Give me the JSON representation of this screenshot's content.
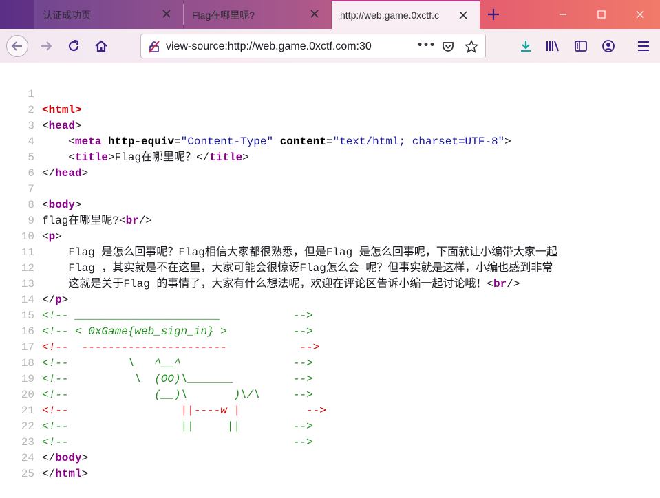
{
  "tabs": [
    {
      "label": "认证成功页",
      "active": false
    },
    {
      "label": "Flag在哪里呢?",
      "active": false
    },
    {
      "label": "http://web.game.0xctf.c",
      "active": true
    }
  ],
  "navbar": {
    "url": "view-source:http://web.game.0xctf.com:30",
    "more_label": "•••"
  },
  "source": {
    "line_numbers": [
      "1",
      "2",
      "3",
      "4",
      "5",
      "6",
      "7",
      "8",
      "9",
      "10",
      "11",
      "12",
      "13",
      "14",
      "15",
      "16",
      "17",
      "18",
      "19",
      "20",
      "21",
      "22",
      "23",
      "24",
      "25"
    ],
    "html_open": "html",
    "head_open": "head",
    "meta_tag": "meta",
    "meta_attr1": "http-equiv",
    "meta_val1": "\"Content-Type\"",
    "meta_attr2": "content",
    "meta_val2": "\"text/html; charset=UTF-8\"",
    "title_tag": "title",
    "title_text": "Flag在哪里呢？",
    "head_close": "head",
    "body_open": "body",
    "line8_text": "flag在哪里呢?",
    "br_tag": "br",
    "p_tag": "p",
    "para1": "Flag 是怎么回事呢？Flag相信大家都很熟悉，但是Flag 是怎么回事呢，下面就让小编带大家一起",
    "para2": "Flag ，其实就是不在这里，大家可能会很惊讶Flag怎么会 呢？但事实就是这样，小编也感到非常",
    "para3": "这就是关于Flag 的事情了，大家有什么想法呢，欢迎在评论区告诉小编一起讨论哦！",
    "comments": [
      "<!-- ______________________           -->",
      "<!-- < 0xGame{web_sign_in} >          -->",
      "<!--  ----------------------           -->",
      "<!--         \\   ^__^                 -->",
      "<!--          \\  (OO)\\_______         -->",
      "<!--             (__)\\       )\\/\\     -->",
      "<!--                 ||----w |          -->",
      "<!--                 ||     ||        -->",
      "<!--                                  -->"
    ],
    "body_close": "body",
    "html_close": "html"
  }
}
